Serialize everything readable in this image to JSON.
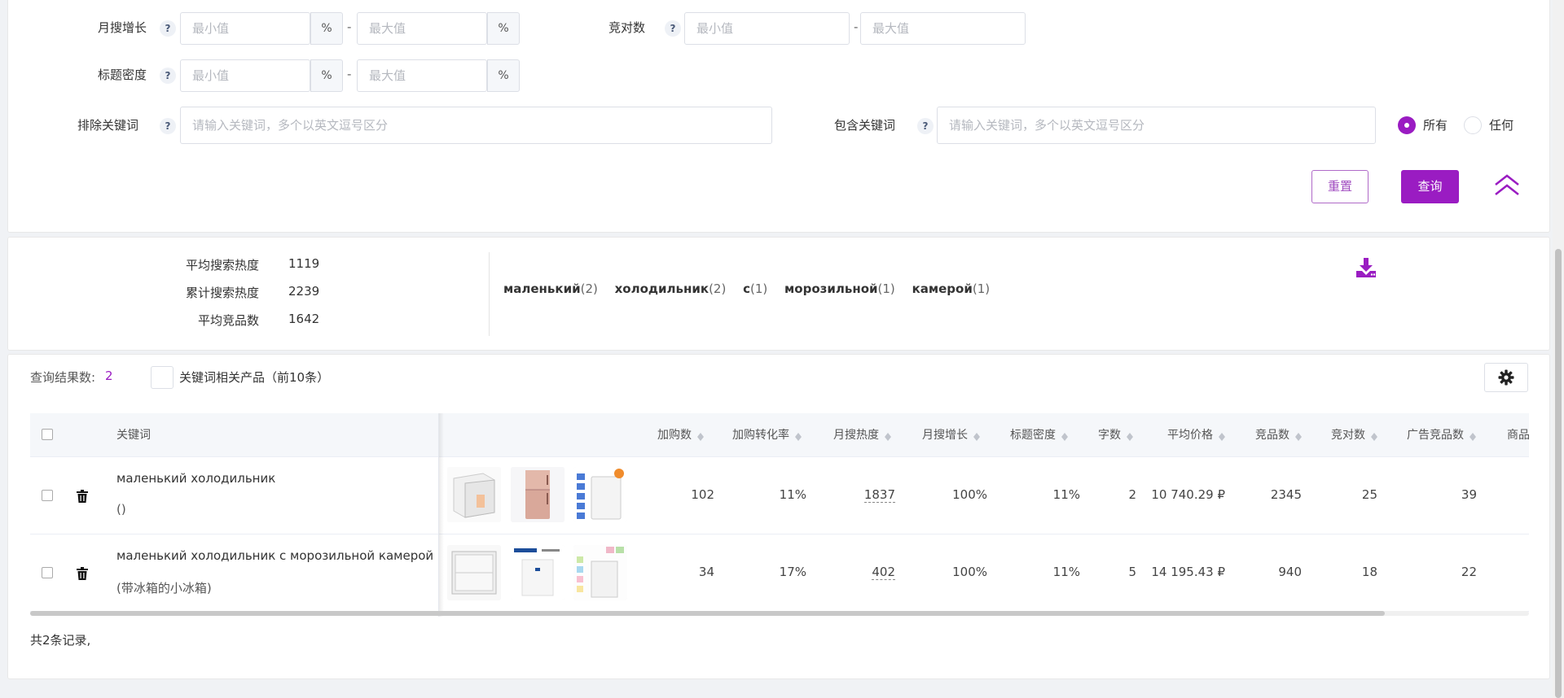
{
  "filters": {
    "monthly_growth": {
      "label": "月搜增长",
      "min_placeholder": "最小值",
      "max_placeholder": "最大值",
      "unit": "%"
    },
    "competitor_count": {
      "label": "竞对数",
      "min_placeholder": "最小值",
      "max_placeholder": "最大值"
    },
    "title_density": {
      "label": "标题密度",
      "min_placeholder": "最小值",
      "max_placeholder": "最大值",
      "unit": "%"
    },
    "exclude_keywords": {
      "label": "排除关键词",
      "placeholder": "请输入关键词，多个以英文逗号区分"
    },
    "include_keywords": {
      "label": "包含关键词",
      "placeholder": "请输入关键词，多个以英文逗号区分"
    },
    "help": "?",
    "dash": "-",
    "match_mode": {
      "all_label": "所有",
      "any_label": "任何",
      "selected": "所有"
    },
    "reset_label": "重置",
    "query_label": "查询"
  },
  "summary": {
    "avg_search_heat_label": "平均搜索热度",
    "avg_search_heat": "1119",
    "total_search_heat_label": "累计搜索热度",
    "total_search_heat": "2239",
    "avg_competitors_label": "平均竞品数",
    "avg_competitors": "1642",
    "word_cloud": [
      {
        "word": "маленький",
        "count": "(2)"
      },
      {
        "word": "холодильник",
        "count": "(2)"
      },
      {
        "word": "с",
        "count": "(1)"
      },
      {
        "word": "морозильной",
        "count": "(1)"
      },
      {
        "word": "камерой",
        "count": "(1)"
      }
    ]
  },
  "results": {
    "count_label": "查询结果数:",
    "count": "2",
    "related_products_label": "关键词相关产品（前10条）",
    "columns": [
      "关键词",
      "加购数",
      "加购转化率",
      "月搜热度",
      "月搜增长",
      "标题密度",
      "字数",
      "平均价格",
      "竞品数",
      "竞对数",
      "广告竞品数",
      "商品可"
    ],
    "rows": [
      {
        "keyword": "маленький холодильник",
        "translation": "()",
        "add_to_cart": "102",
        "conversion": "11%",
        "monthly_heat": "1837",
        "monthly_growth": "100%",
        "title_density": "11%",
        "word_count": "2",
        "avg_price": "10 740.29 ₽",
        "competitors": "2345",
        "rivals": "25",
        "ad_competitors": "39"
      },
      {
        "keyword": "маленький холодильник с морозильной камерой",
        "translation": "(带冰箱的小冰箱)",
        "add_to_cart": "34",
        "conversion": "17%",
        "monthly_heat": "402",
        "monthly_growth": "100%",
        "title_density": "11%",
        "word_count": "5",
        "avg_price": "14 195.43 ₽",
        "competitors": "940",
        "rivals": "18",
        "ad_competitors": "22"
      }
    ],
    "total_text": "共2条记录,"
  },
  "colors": {
    "accent": "#9a1cc2"
  },
  "icons": [
    "help-icon",
    "radio-icon",
    "chevron-up-double-icon",
    "download-icon",
    "gear-icon",
    "trash-icon",
    "sort-icon"
  ]
}
